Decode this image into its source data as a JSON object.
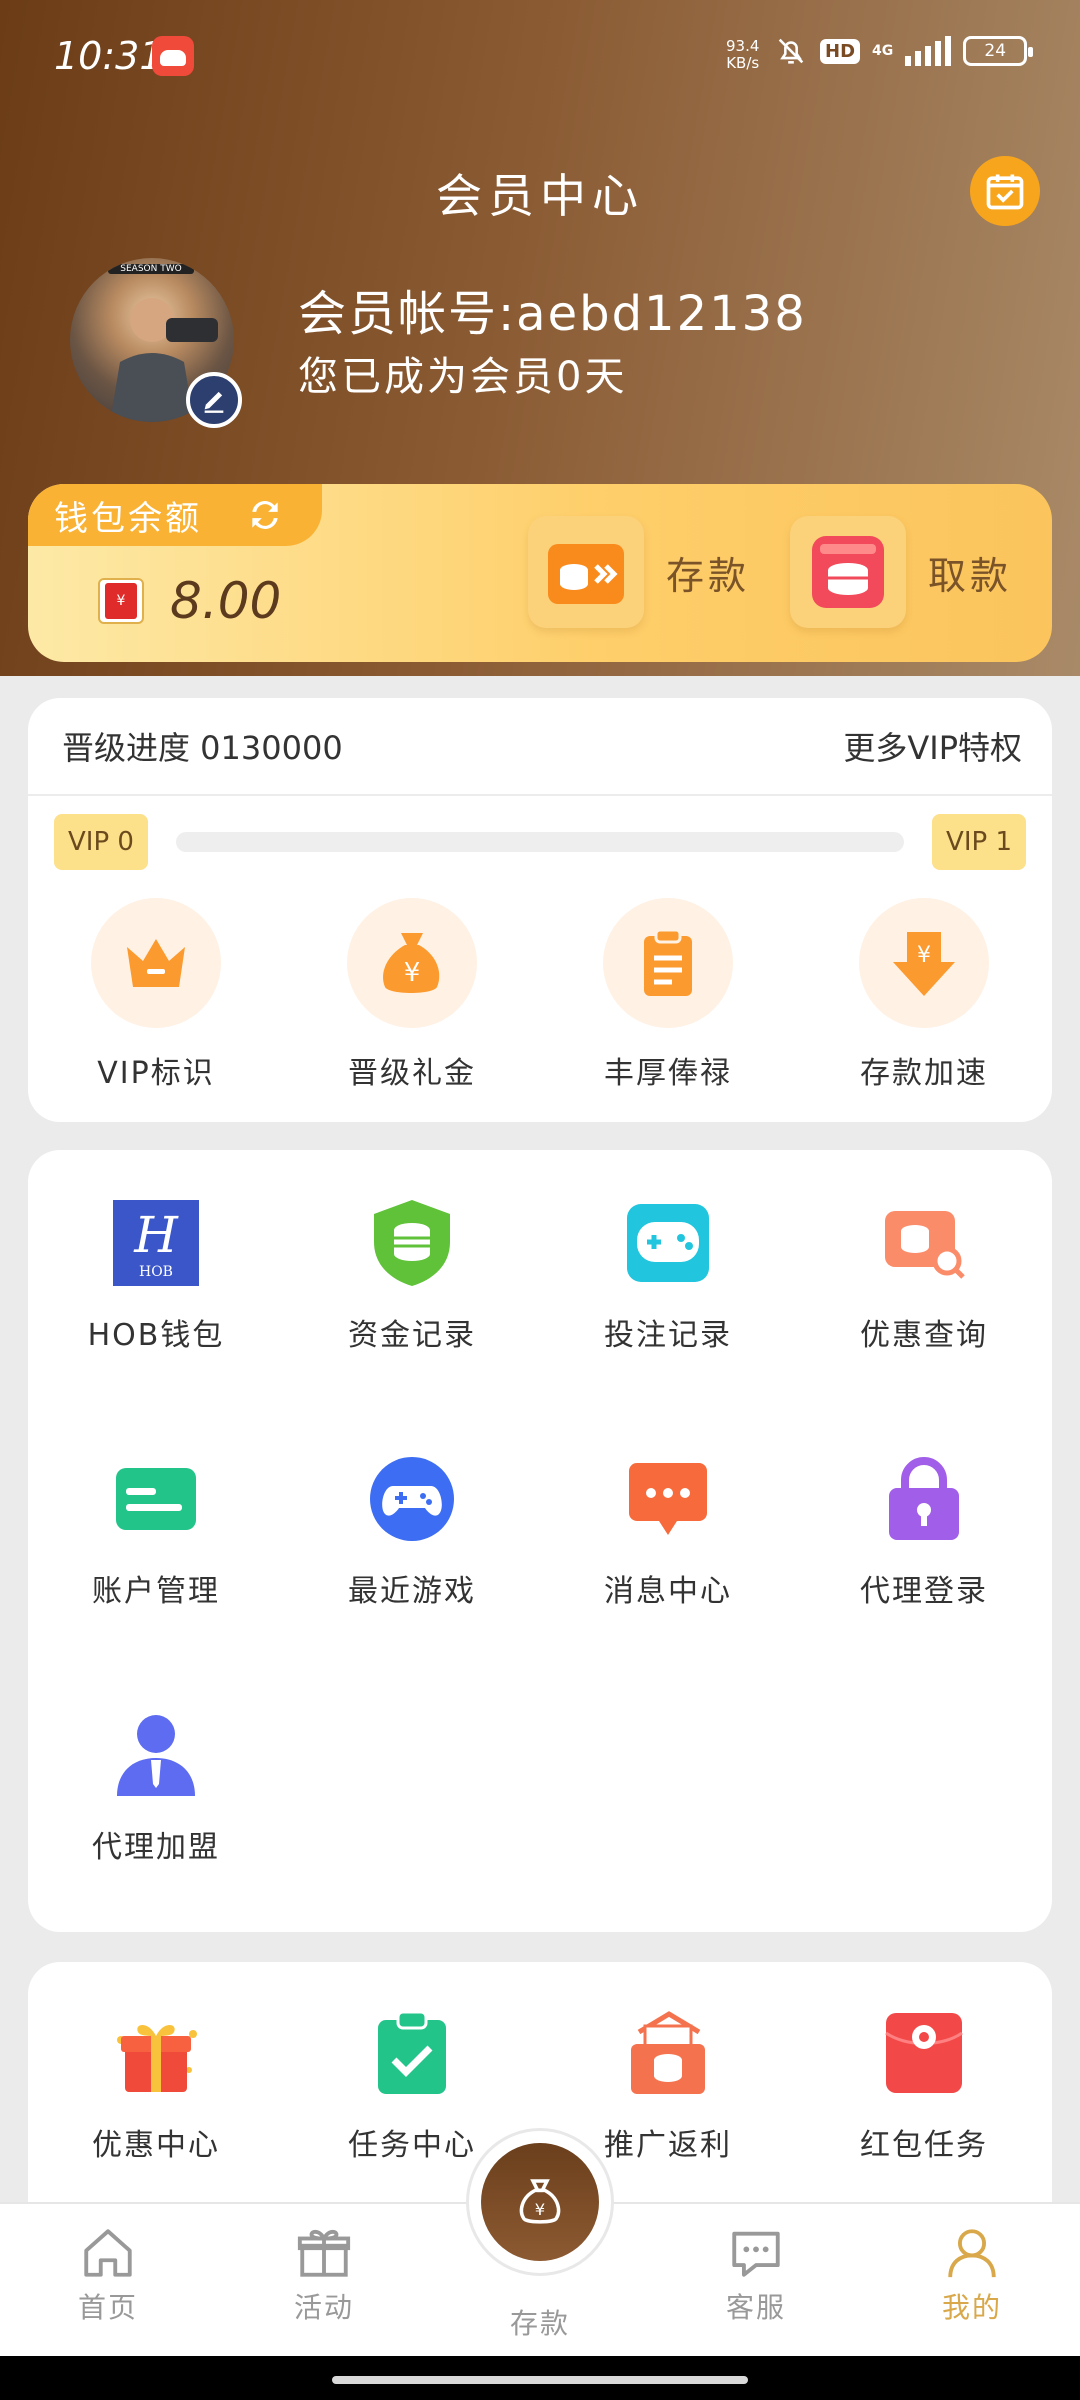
{
  "status_bar": {
    "time": "10:31",
    "net_speed_value": "93.4",
    "net_speed_unit": "KB/s",
    "hd": "HD",
    "network": "4G",
    "battery": "24"
  },
  "header": {
    "title": "会员中心",
    "account": "会员帐号:aebd12138",
    "member_days": "您已成为会员0天",
    "avatar_caption": "SEASON TWO"
  },
  "wallet": {
    "label": "钱包余额",
    "currency_symbol": "¥",
    "balance": "8.00",
    "deposit_label": "存款",
    "withdraw_label": "取款"
  },
  "vip": {
    "progress_label": "晋级进度 0130000",
    "more_link": "更多VIP特权",
    "current_level": "VIP 0",
    "next_level": "VIP 1",
    "progress": 0,
    "perks": [
      {
        "label": "VIP标识",
        "icon": "crown-icon"
      },
      {
        "label": "晋级礼金",
        "icon": "money-bag-icon"
      },
      {
        "label": "丰厚俸禄",
        "icon": "clipboard-icon"
      },
      {
        "label": "存款加速",
        "icon": "deposit-arrow-icon"
      }
    ]
  },
  "services": [
    {
      "label": "HOB钱包",
      "icon": "hob-wallet-icon",
      "logo_text": "H",
      "logo_sub": "HOB"
    },
    {
      "label": "资金记录",
      "icon": "fund-shield-icon"
    },
    {
      "label": "投注记录",
      "icon": "gamepad-icon"
    },
    {
      "label": "优惠查询",
      "icon": "coupon-search-icon"
    },
    {
      "label": "账户管理",
      "icon": "card-icon"
    },
    {
      "label": "最近游戏",
      "icon": "game-controller-icon"
    },
    {
      "label": "消息中心",
      "icon": "message-icon"
    },
    {
      "label": "代理登录",
      "icon": "lock-icon"
    },
    {
      "label": "代理加盟",
      "icon": "agent-person-icon"
    }
  ],
  "activities": [
    {
      "label": "优惠中心",
      "icon": "gift-icon"
    },
    {
      "label": "任务中心",
      "icon": "task-clipboard-icon"
    },
    {
      "label": "推广返利",
      "icon": "promotion-icon"
    },
    {
      "label": "红包任务",
      "icon": "red-envelope-icon"
    }
  ],
  "tabbar": {
    "home": "首页",
    "activity": "活动",
    "deposit": "存款",
    "service": "客服",
    "mine": "我的"
  },
  "colors": {
    "accent": "#d8a84a",
    "header_start": "#6b3c16",
    "header_end": "#a98a68",
    "wallet_tab": "#f9b234"
  }
}
